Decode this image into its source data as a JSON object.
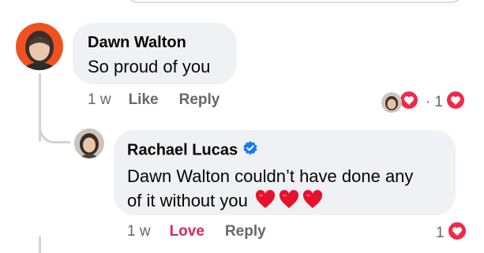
{
  "comments": [
    {
      "author": "Dawn Walton",
      "text": "So proud of you",
      "time": "1 w",
      "like_label": "Like",
      "reply_label": "Reply",
      "reactions": {
        "separator": "·",
        "count": "1"
      }
    },
    {
      "author": "Rachael Lucas",
      "verified": true,
      "text_line1": "Dawn Walton couldn’t have done any",
      "text_line2": "of it without you",
      "emoji_hearts": 3,
      "time": "1 w",
      "love_label": "Love",
      "reply_label": "Reply",
      "reaction_count": "1"
    }
  ],
  "colors": {
    "bubble": "#eff1f4",
    "love": "#e0245e",
    "heart": "#f02849",
    "verified": "#1877f2",
    "meta": "#65676b"
  },
  "icons": [
    "love-reaction-icon",
    "verified-badge-icon",
    "red-heart-emoji-icon"
  ]
}
